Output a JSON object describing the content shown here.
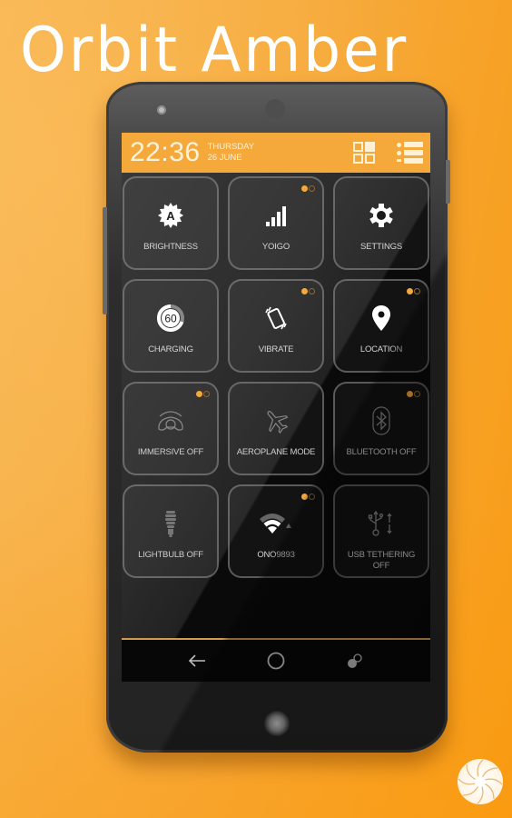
{
  "promo": {
    "title": "Orbit Amber"
  },
  "colors": {
    "accent": "#f5a93b",
    "background": "#f7a935",
    "screen": "#0b0b0b"
  },
  "status_bar": {
    "time": "22:36",
    "day": "THURSDAY",
    "date": "26 JUNE",
    "icons": [
      "grid-view-icon",
      "list-view-icon"
    ]
  },
  "tiles": [
    {
      "label": "BRIGHTNESS",
      "icon": "brightness-auto-icon",
      "dots": false,
      "state": "on"
    },
    {
      "label": "YOIGO",
      "icon": "signal-icon",
      "dots": true,
      "state": "on"
    },
    {
      "label": "SETTINGS",
      "icon": "gear-icon",
      "dots": false,
      "state": "on"
    },
    {
      "label": "CHARGING",
      "icon": "battery-60-icon",
      "value": "60",
      "dots": false,
      "state": "on"
    },
    {
      "label": "VIBRATE",
      "icon": "vibrate-icon",
      "dots": true,
      "state": "on"
    },
    {
      "label": "LOCATION",
      "icon": "location-pin-icon",
      "dots": true,
      "state": "on"
    },
    {
      "label": "IMMERSIVE OFF",
      "icon": "immersive-icon",
      "dots": true,
      "state": "off"
    },
    {
      "label": "AEROPLANE MODE",
      "icon": "airplane-icon",
      "dots": false,
      "state": "off"
    },
    {
      "label": "BLUETOOTH OFF",
      "icon": "bluetooth-icon",
      "dots": true,
      "state": "off"
    },
    {
      "label": "LIGHTBULB OFF",
      "icon": "lightbulb-icon",
      "dots": false,
      "state": "off"
    },
    {
      "label": "ONO9893",
      "icon": "wifi-icon",
      "dots": true,
      "state": "on"
    },
    {
      "label": "USB TETHERING OFF",
      "icon": "usb-icon",
      "dots": false,
      "state": "off"
    }
  ],
  "nav": {
    "back": "back-icon",
    "home": "home-icon",
    "recents": "recents-icon"
  }
}
